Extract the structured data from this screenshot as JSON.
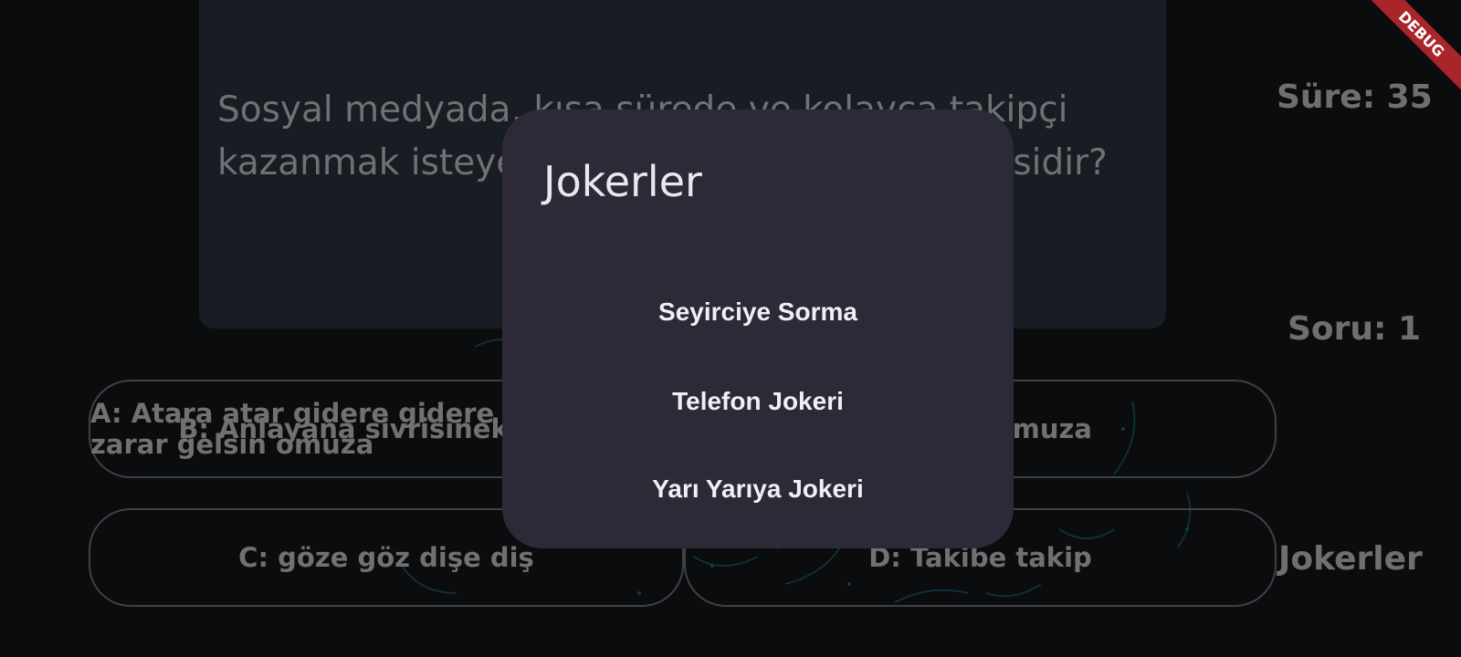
{
  "question": {
    "text": "Sosyal medyada, kısa sürede ve kolayca takipçi kazanmak isteyenler için söylenen söz hangisidir?"
  },
  "answers": [
    {
      "letter": "A",
      "label": "A: Atara atar gidere gidere gerek, zarar gelsin omuza"
    },
    {
      "letter": "B",
      "label": "B: Anlayana sivrisinek saz, anlamayana davul zurna az, muza"
    },
    {
      "letter": "C",
      "label": "C: göze göz dişe diş"
    },
    {
      "letter": "D",
      "label": "D: Takibe takip"
    }
  ],
  "status": {
    "timer": "Süre: 35",
    "question_number": "Soru: 1",
    "jokers_button": "Jokerler"
  },
  "dialog": {
    "title": "Jokerler",
    "options": [
      "Seyirciye Sorma",
      "Telefon Jokeri",
      "Yarı Yarıya Jokeri"
    ]
  },
  "debug_banner": "DEBUG",
  "colors": {
    "dialog_background": "#2d2a38",
    "card_background": "#181d23",
    "debug_banner": "#a8262a"
  }
}
